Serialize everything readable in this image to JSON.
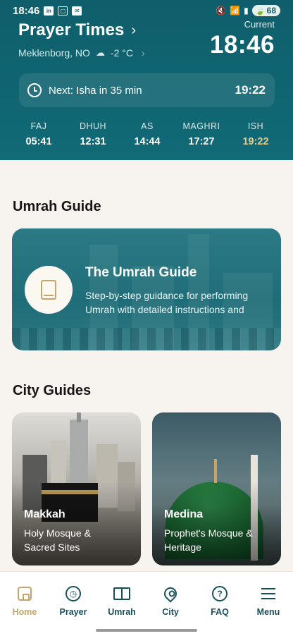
{
  "status_bar": {
    "time": "18:46",
    "battery": "68",
    "icons": [
      "linkedin-icon",
      "screenshot-icon",
      "mail-icon",
      "mute-icon",
      "wifi-icon",
      "signal-icon",
      "battery-icon"
    ]
  },
  "header": {
    "title": "Prayer Times",
    "location": "Meklenborg, NO",
    "weather": "-2 °C",
    "current_label": "Current",
    "current_time": "18:46",
    "next_label": "Next: Isha in 35 min",
    "next_time": "19:22",
    "prayers": [
      {
        "name": "FAJ",
        "time": "05:41"
      },
      {
        "name": "DHUH",
        "time": "12:31"
      },
      {
        "name": "AS",
        "time": "14:44"
      },
      {
        "name": "MAGHRI",
        "time": "17:27"
      },
      {
        "name": "ISH",
        "time": "19:22"
      }
    ]
  },
  "umrah": {
    "section_title": "Umrah Guide",
    "card_title": "The Umrah Guide",
    "card_desc": "Step-by-step guidance for performing Umrah with detailed instructions and"
  },
  "cities": {
    "section_title": "City Guides",
    "items": [
      {
        "name": "Makkah",
        "desc_line1": "Holy Mosque &",
        "desc_line2": "Sacred Sites"
      },
      {
        "name": "Medina",
        "desc_line1": "Prophet's Mosque &",
        "desc_line2": "Heritage"
      }
    ]
  },
  "nav": {
    "items": [
      {
        "label": "Home",
        "icon": "home-icon"
      },
      {
        "label": "Prayer",
        "icon": "clock-icon"
      },
      {
        "label": "Umrah",
        "icon": "book-icon"
      },
      {
        "label": "City",
        "icon": "location-pin-icon"
      },
      {
        "label": "FAQ",
        "icon": "help-icon"
      },
      {
        "label": "Menu",
        "icon": "menu-icon"
      }
    ]
  },
  "colors": {
    "header_teal": "#0f5e6b",
    "accent_gold": "#c9a46a",
    "background": "#f7f4ef"
  }
}
